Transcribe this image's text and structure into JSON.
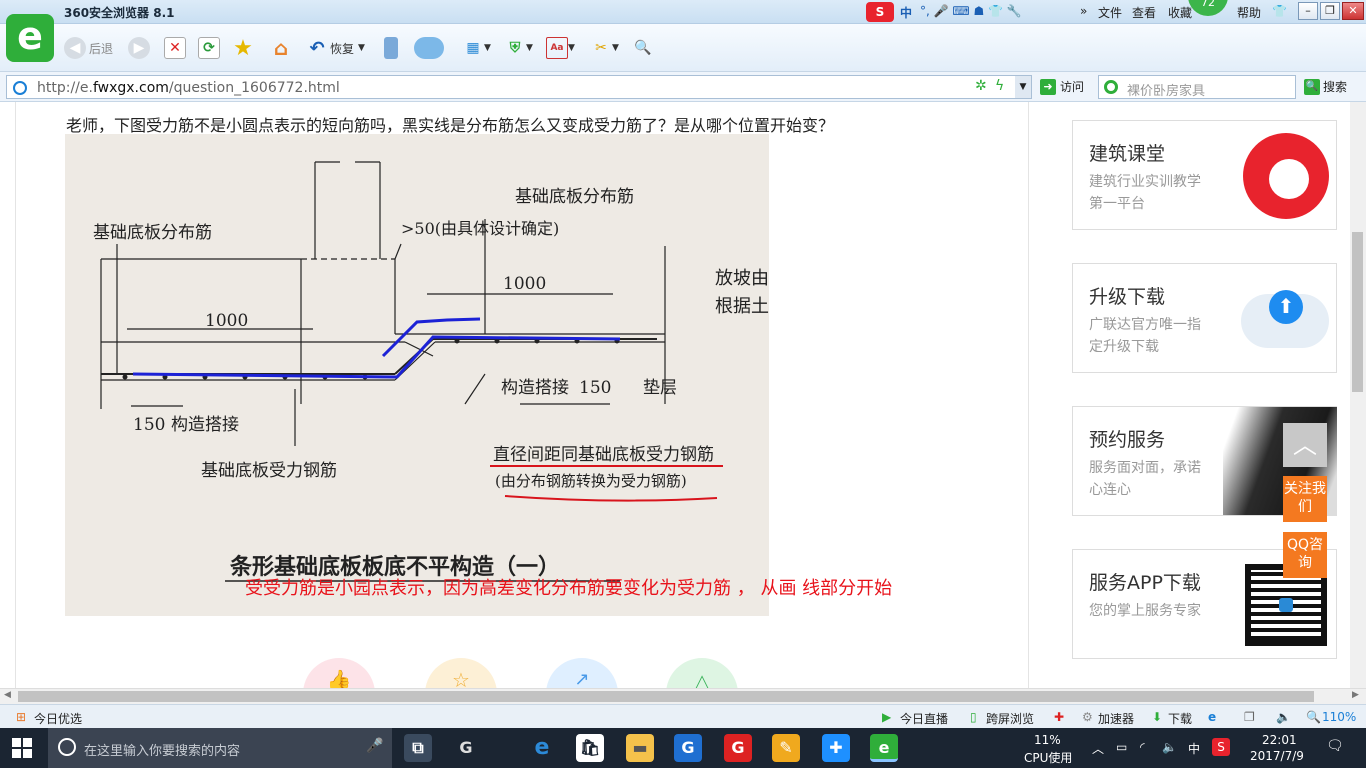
{
  "browser": {
    "title": "360安全浏览器 8.1",
    "menus": [
      "文件",
      "查看",
      "收藏",
      "帮助"
    ],
    "badge": "72",
    "ime": "中",
    "toolbar": {
      "back_label": "后退",
      "restore_label": "恢复"
    },
    "address": {
      "prefix": "http://e.",
      "domain": "fwxgx.com",
      "path": "/question_1606772.html"
    },
    "visit_label": "访问",
    "search_placeholder": "裸价卧房家具",
    "search_label": "搜索"
  },
  "page": {
    "question": "老师，下图受力筋不是小圆点表示的短向筋吗，黑实线是分布筋怎么又变成受力筋了？是从哪个位置开始变？",
    "answer_note": "受受力筋是小园点表示，因为高差变化分布筋要变化为受力筋 ， 从画 线部分开始",
    "diagram": {
      "label_dist_left": "基础底板分布筋",
      "label_dist_right": "基础底板分布筋",
      "label_min": ">50(由具体设计确定)",
      "dim_1000_left": "1000",
      "dim_1000_right": "1000",
      "label_slope_1": "放坡由",
      "label_slope_2": "根据土",
      "label_lap_right": "构造搭接",
      "dim_150_right": "150",
      "label_pad": "垫层",
      "dim_150_left": "150",
      "label_lap_left": "构造搭接",
      "label_main_left": "基础底板受力钢筋",
      "note_line1": "直径间距同基础底板受力钢筋",
      "note_line2": "(由分布钢筋转换为受力钢筋)",
      "caption": "条形基础底板板底不平构造（一）"
    }
  },
  "sidebar": {
    "cards": [
      {
        "title": "建筑课堂",
        "desc": "建筑行业实训教学第一平台"
      },
      {
        "title": "升级下载",
        "desc": "广联达官方唯一指定升级下载"
      },
      {
        "title": "预约服务",
        "desc": "服务面对面，承诺心连心"
      },
      {
        "title": "服务APP下载",
        "desc": "您的掌上服务专家"
      }
    ],
    "follow": "关注我们",
    "qq": "QQ咨询"
  },
  "statusbar": {
    "today_pick": "今日优选",
    "live": "今日直播",
    "cross_screen": "跨屏浏览",
    "accelerator": "加速器",
    "download": "下载",
    "zoom": "110%"
  },
  "taskbar": {
    "search_placeholder": "在这里输入你要搜索的内容",
    "cpu_percent": "11%",
    "cpu_label": "CPU使用",
    "ime": "中",
    "time": "22:01",
    "date": "2017/7/9"
  },
  "colors": {
    "accent_green": "#2fae3a",
    "note_red": "#e8131b",
    "orange": "#f47920",
    "taskbar": "#1b2532"
  }
}
